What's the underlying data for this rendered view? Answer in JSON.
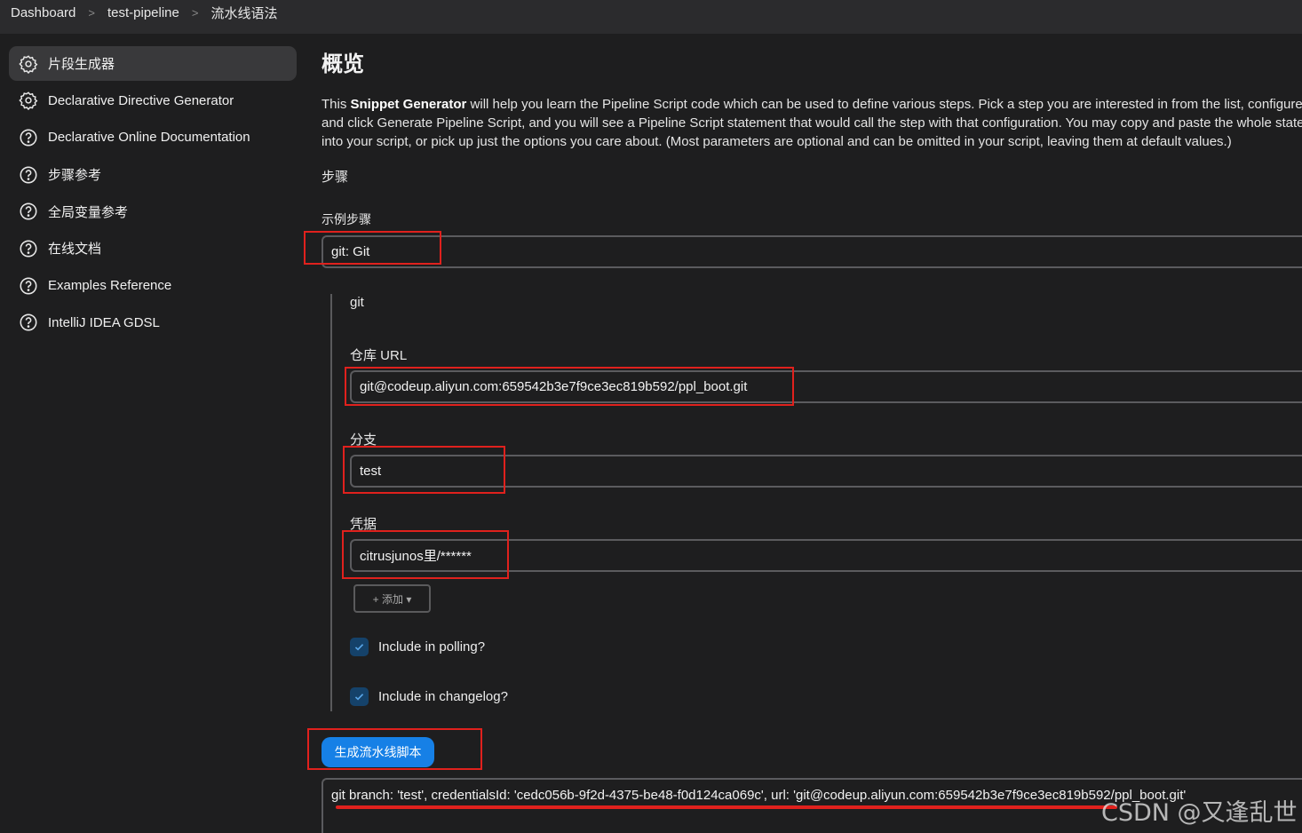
{
  "breadcrumb": {
    "items": [
      "Dashboard",
      "test-pipeline",
      "流水线语法"
    ],
    "separator": ">"
  },
  "sidebar": {
    "items": [
      {
        "label": "片段生成器",
        "icon": "gear-icon",
        "active": true
      },
      {
        "label": "Declarative Directive Generator",
        "icon": "gear-icon"
      },
      {
        "label": "Declarative Online Documentation",
        "icon": "help-icon"
      },
      {
        "label": "步骤参考",
        "icon": "help-icon"
      },
      {
        "label": "全局变量参考",
        "icon": "help-icon"
      },
      {
        "label": "在线文档",
        "icon": "help-icon"
      },
      {
        "label": "Examples Reference",
        "icon": "help-icon"
      },
      {
        "label": "IntelliJ IDEA GDSL",
        "icon": "help-icon"
      }
    ]
  },
  "main": {
    "title": "概览",
    "intro_prefix": "This ",
    "intro_bold": "Snippet Generator",
    "intro_rest": " will help you learn the Pipeline Script code which can be used to define various steps. Pick a step you are interested in from the list, configure it, and click Generate Pipeline Script, and you will see a Pipeline Script statement that would call the step with that configuration. You may copy and paste the whole statement into your script, or pick up just the options you care about. (Most parameters are optional and can be omitted in your script, leaving them at default values.)",
    "steps_heading": "步骤",
    "sample_step_label": "示例步骤",
    "sample_step_value": "git: Git",
    "step_name": "git",
    "repo_url_label": "仓库 URL",
    "repo_url_value": "git@codeup.aliyun.com:659542b3e7f9ce3ec819b592/ppl_boot.git",
    "branch_label": "分支",
    "branch_value": "test",
    "credentials_label": "凭据",
    "credentials_value": "citrusjunos里/******",
    "add_button": "+ 添加 ▾",
    "include_polling_label": "Include in polling?",
    "include_changelog_label": "Include in changelog?",
    "generate_button": "生成流水线脚本",
    "generated_script": "git branch: 'test', credentialsId: 'cedc056b-9f2d-4375-be48-f0d124ca069c', url: 'git@codeup.aliyun.com:659542b3e7f9ce3ec819b592/ppl_boot.git'"
  },
  "watermark": "CSDN @又逢乱世",
  "colors": {
    "background": "#1e1e1f",
    "accent": "#1680e6",
    "annotation_red": "#e0211d",
    "checkbox": "#15426a"
  }
}
